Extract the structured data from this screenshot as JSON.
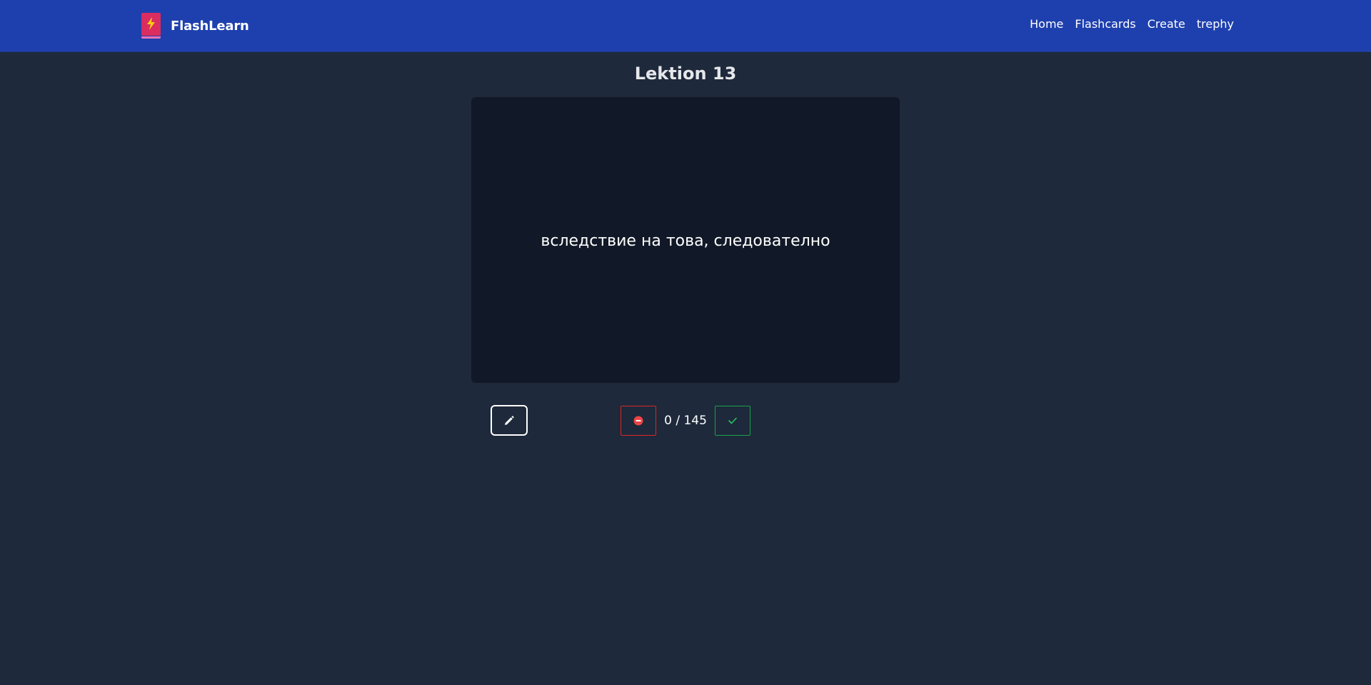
{
  "navbar": {
    "brand": "FlashLearn",
    "links": [
      "Home",
      "Flashcards",
      "Create",
      "trephy"
    ]
  },
  "deck": {
    "title": "Lektion 13"
  },
  "card": {
    "text": "вследствие на това, следователно"
  },
  "controls": {
    "progress": "0 / 145",
    "edit_icon": "pencil-icon",
    "wrong_icon": "minus-circle-icon",
    "right_icon": "check-icon"
  },
  "colors": {
    "navbar": "#1e40af",
    "background": "#1e293b",
    "card": "#111827",
    "wrong": "#dc2626",
    "right": "#16a34a",
    "logo": "#db2d5f"
  }
}
